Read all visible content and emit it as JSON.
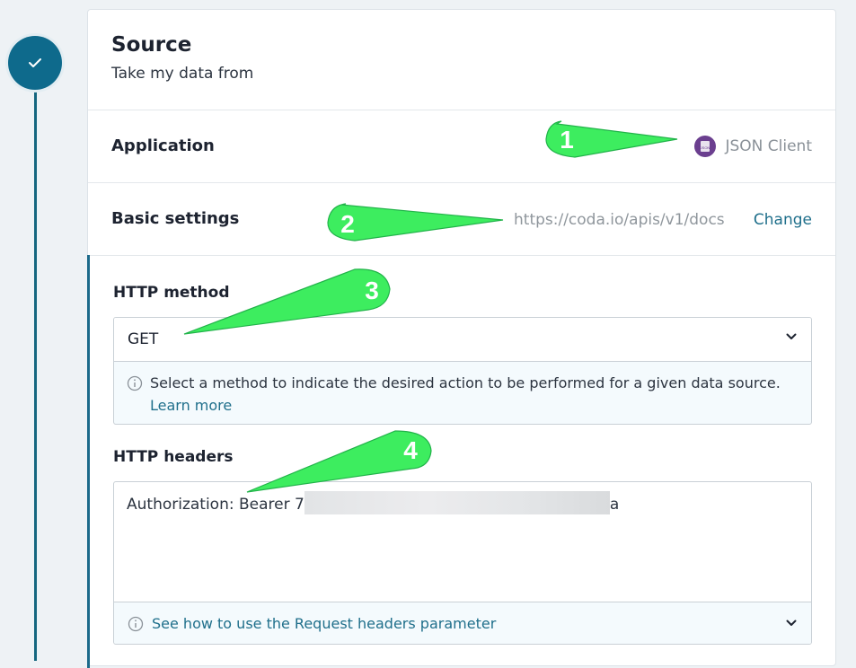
{
  "source": {
    "title": "Source",
    "subtitle": "Take my data from"
  },
  "application": {
    "label": "Application",
    "value": "JSON Client",
    "logo_text": "JSON"
  },
  "basic_settings": {
    "label": "Basic settings",
    "url": "https://coda.io/apis/v1/docs",
    "change_label": "Change"
  },
  "http_method": {
    "label": "HTTP method",
    "value": "GET",
    "help_text": "Select a method to indicate the desired action to be performed for a given data source.",
    "learn_more": "Learn more"
  },
  "http_headers": {
    "label": "HTTP headers",
    "value_prefix": "Authorization: Bearer 7",
    "value_suffix": "a",
    "help_link": "See how to use the Request headers parameter"
  },
  "callouts": [
    "1",
    "2",
    "3",
    "4"
  ],
  "colors": {
    "step_circle": "#0e6a8c",
    "link": "#1f6f8b",
    "callout": "#3ded5f"
  },
  "icons": {
    "step": "check-icon",
    "info": "info-icon",
    "dropdown": "chevron-down-icon"
  }
}
